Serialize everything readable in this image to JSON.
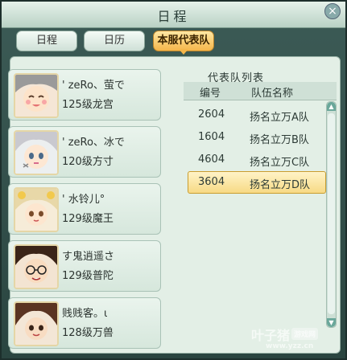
{
  "window": {
    "title": "日程",
    "close_symbol": "×"
  },
  "tabs": [
    {
      "label": "日程"
    },
    {
      "label": "日历"
    },
    {
      "label": "本服代表队"
    }
  ],
  "members": [
    {
      "name": "' zeRo、萤で",
      "level": "125级龙宫"
    },
    {
      "name": "' zeRo、冰で",
      "level": "120级方寸"
    },
    {
      "name": "' 水铃儿°",
      "level": "129级魔王"
    },
    {
      "name": "す鬼逍遥さ",
      "level": "129级普陀"
    },
    {
      "name": "贱贱客。ι",
      "level": "128级万兽"
    }
  ],
  "team_list": {
    "title": "代表队列表",
    "headers": {
      "id": "编号",
      "name": "队伍名称"
    },
    "rows": [
      {
        "id": "2604",
        "name": "扬名立万A队"
      },
      {
        "id": "1604",
        "name": "扬名立万B队"
      },
      {
        "id": "4604",
        "name": "扬名立万C队"
      },
      {
        "id": "3604",
        "name": "扬名立万D队"
      }
    ],
    "selected_index": 3
  },
  "scrollbar": {
    "up": "▲",
    "down": "▼"
  },
  "watermark": {
    "main": "叶子猪",
    "tag": "游戏网",
    "sub": "www.yzz.cn"
  },
  "colors": {
    "accent": "#f5b64a",
    "panel": "#e3efe6"
  }
}
